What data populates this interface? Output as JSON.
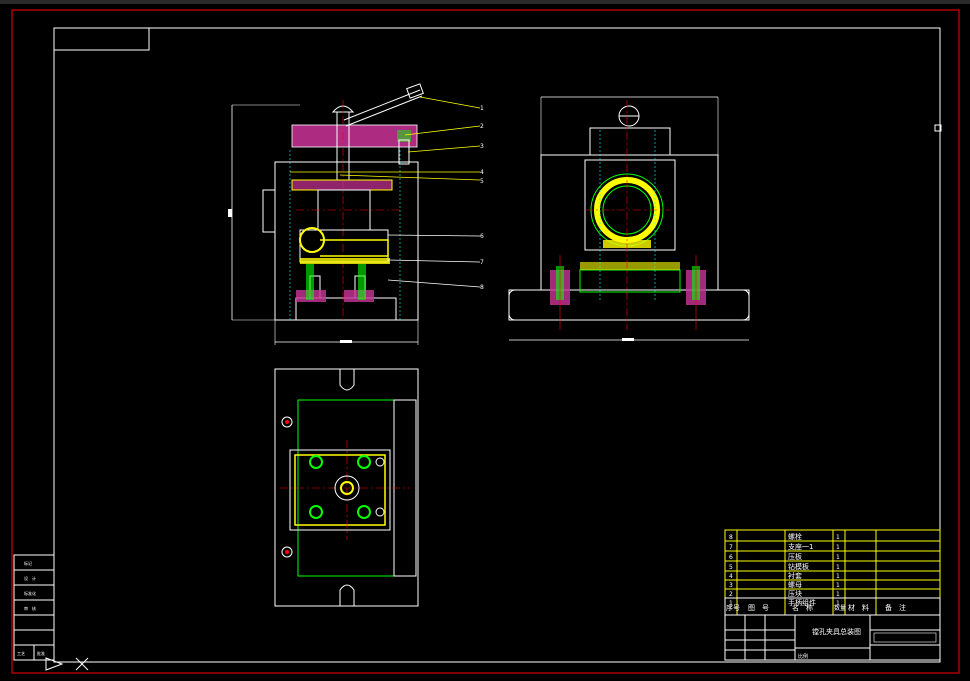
{
  "drawing": {
    "title": "镗孔夹具总装图",
    "scale_note": "比例",
    "colors": {
      "background": "#000000",
      "frame": "#ff0000",
      "outline": "#ffffff",
      "part": "#00ff00",
      "leader": "#ffff00",
      "center": "#ff0000",
      "hatch": "#cc3399",
      "cyan": "#00ffff"
    }
  },
  "bom": {
    "header": [
      "序号",
      "图　号",
      "名　称",
      "数量",
      "材　料",
      "备　注"
    ],
    "rows": [
      {
        "no": "8",
        "name": "螺栓",
        "qty": "1"
      },
      {
        "no": "7",
        "name": "支座一1",
        "qty": "1"
      },
      {
        "no": "6",
        "name": "压板",
        "qty": "1"
      },
      {
        "no": "5",
        "name": "钻模板",
        "qty": "1"
      },
      {
        "no": "4",
        "name": "衬套",
        "qty": "1"
      },
      {
        "no": "3",
        "name": "螺母",
        "qty": "1"
      },
      {
        "no": "2",
        "name": "压块",
        "qty": "1"
      },
      {
        "no": "1",
        "name": "手柄组件",
        "qty": "1"
      }
    ]
  },
  "title_block": {
    "drawing_name": "镗孔夹具总装图",
    "label_1": "比例"
  },
  "side_panel": {
    "labels": [
      "标记",
      "设　计",
      "标准化",
      "审　核",
      "工艺",
      "批准"
    ]
  },
  "balloons": [
    "1",
    "2",
    "3",
    "4",
    "5",
    "6",
    "7",
    "8"
  ]
}
